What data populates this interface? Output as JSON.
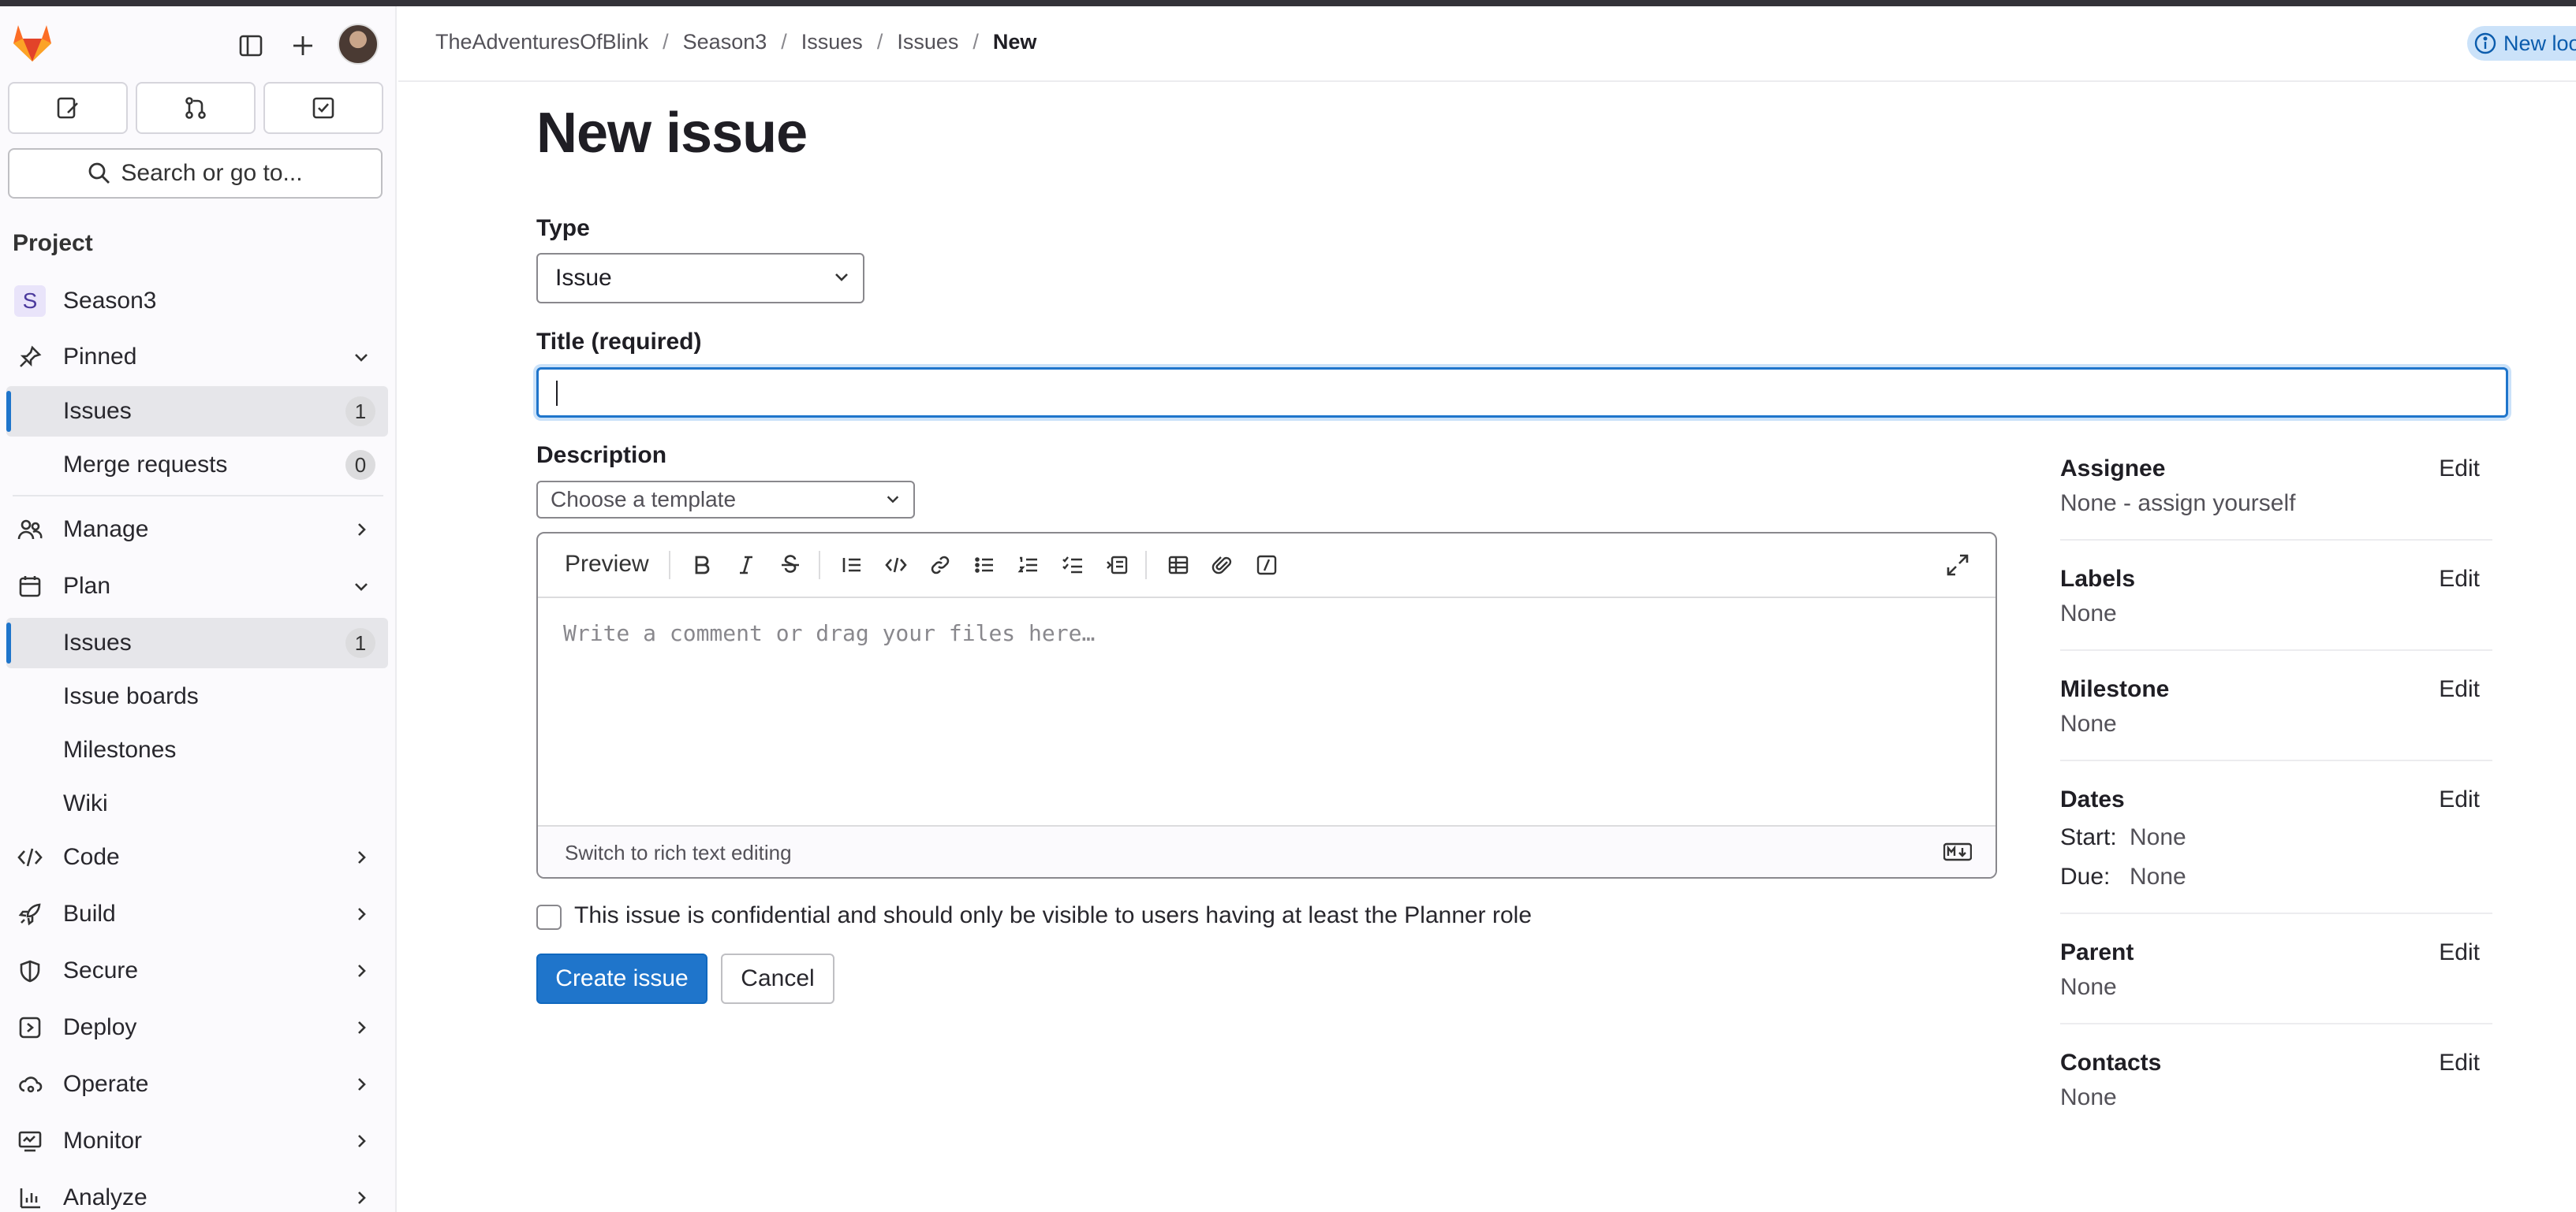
{
  "sidebar": {
    "search_label": "Search or go to...",
    "section_title": "Project",
    "project": {
      "initial": "S",
      "name": "Season3"
    },
    "pinned": {
      "label": "Pinned"
    },
    "pinned_items": [
      {
        "label": "Issues",
        "count": "1"
      },
      {
        "label": "Merge requests",
        "count": "0"
      }
    ],
    "manage": {
      "label": "Manage"
    },
    "plan": {
      "label": "Plan"
    },
    "plan_items": [
      {
        "label": "Issues",
        "count": "1"
      },
      {
        "label": "Issue boards"
      },
      {
        "label": "Milestones"
      },
      {
        "label": "Wiki"
      }
    ],
    "groups": [
      {
        "label": "Code"
      },
      {
        "label": "Build"
      },
      {
        "label": "Secure"
      },
      {
        "label": "Deploy"
      },
      {
        "label": "Operate"
      },
      {
        "label": "Monitor"
      },
      {
        "label": "Analyze"
      }
    ]
  },
  "breadcrumb": [
    "TheAdventuresOfBlink",
    "Season3",
    "Issues",
    "Issues",
    "New"
  ],
  "header_pill": "New loo",
  "page_title": "New issue",
  "form": {
    "type_label": "Type",
    "type_value": "Issue",
    "title_label": "Title (required)",
    "title_value": "",
    "description_label": "Description",
    "template_placeholder": "Choose a template",
    "preview_label": "Preview",
    "editor_placeholder": "Write a comment or drag your files here…",
    "switch_label": "Switch to rich text editing",
    "confidential_label": "This issue is confidential and should only be visible to users having at least the Planner role",
    "create_label": "Create issue",
    "cancel_label": "Cancel"
  },
  "details": {
    "edit_label": "Edit",
    "assignee": {
      "title": "Assignee",
      "value": "None - assign yourself"
    },
    "labels": {
      "title": "Labels",
      "value": "None"
    },
    "milestone": {
      "title": "Milestone",
      "value": "None"
    },
    "dates": {
      "title": "Dates",
      "start_label": "Start:",
      "start_value": "None",
      "due_label": "Due:",
      "due_value": "None"
    },
    "parent": {
      "title": "Parent",
      "value": "None"
    },
    "contacts": {
      "title": "Contacts",
      "value": "None"
    }
  },
  "colors": {
    "accent": "#1f75cb",
    "sidebar_bg": "#fbfafd",
    "logo_orange": "#fc6d26"
  }
}
